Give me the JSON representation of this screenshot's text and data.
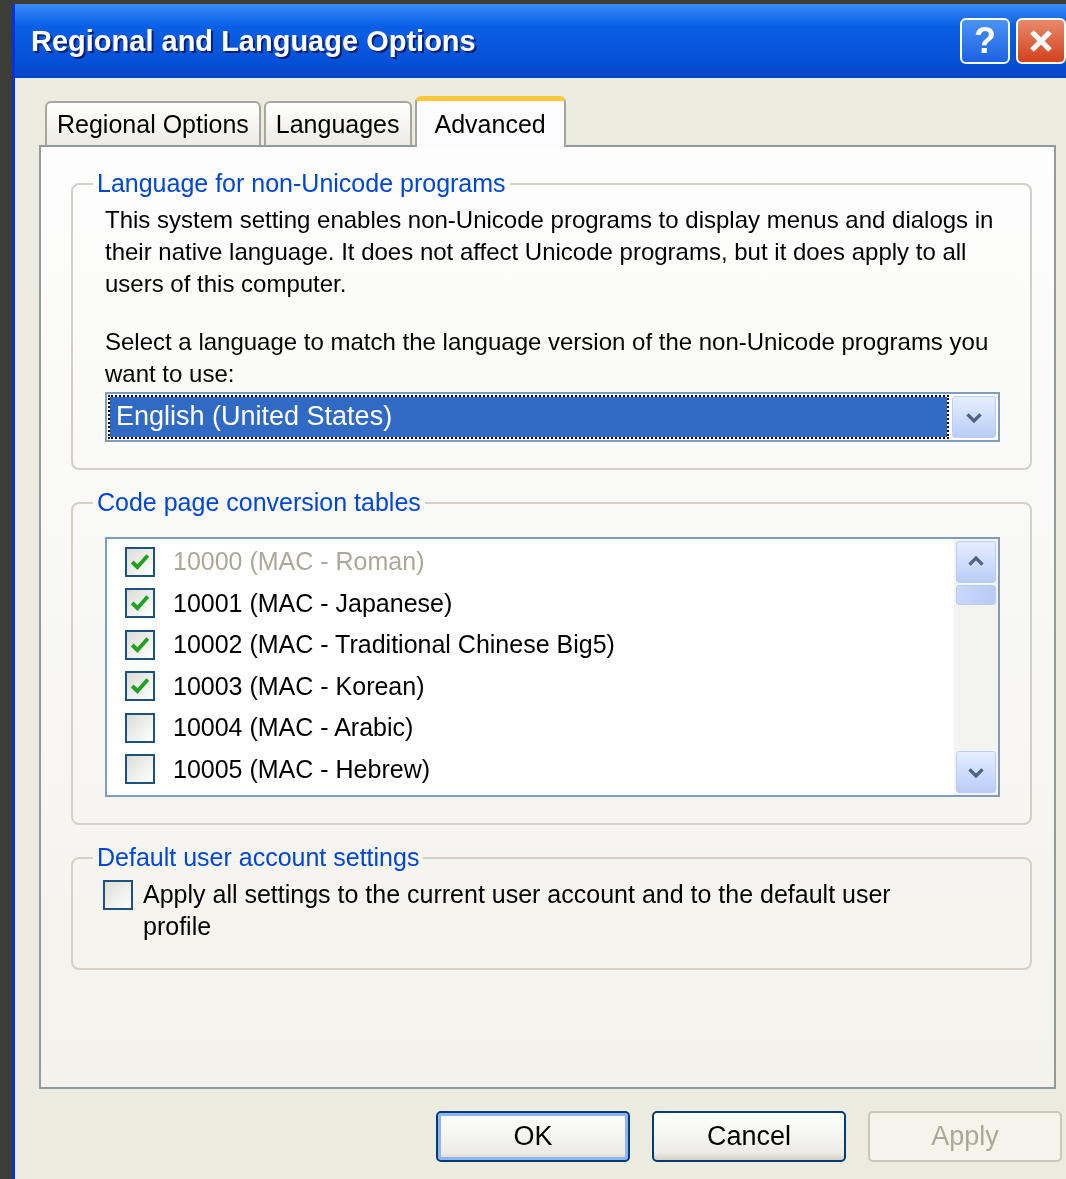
{
  "window": {
    "title": "Regional and Language Options",
    "help_label": "?"
  },
  "tabs": [
    {
      "label": "Regional Options",
      "selected": false
    },
    {
      "label": "Languages",
      "selected": false
    },
    {
      "label": "Advanced",
      "selected": true
    }
  ],
  "non_unicode": {
    "legend": "Language for non-Unicode programs",
    "description": "This system setting enables non-Unicode programs to display menus and dialogs in their native language. It does not affect Unicode programs, but it does apply to all users of this computer.",
    "prompt": "Select a language to match the language version of the non-Unicode programs you want to use:",
    "language": "English (United States)"
  },
  "code_pages": {
    "legend": "Code page conversion tables",
    "items": [
      {
        "label": "10000 (MAC - Roman)",
        "checked": true,
        "disabled": true
      },
      {
        "label": "10001 (MAC - Japanese)",
        "checked": true,
        "disabled": false
      },
      {
        "label": "10002 (MAC - Traditional Chinese Big5)",
        "checked": true,
        "disabled": false
      },
      {
        "label": "10003 (MAC - Korean)",
        "checked": true,
        "disabled": false
      },
      {
        "label": "10004 (MAC - Arabic)",
        "checked": false,
        "disabled": false
      },
      {
        "label": "10005 (MAC - Hebrew)",
        "checked": false,
        "disabled": false
      }
    ]
  },
  "default_account": {
    "legend": "Default user account settings",
    "label": "Apply all settings to the current user account and to the default user profile",
    "checked": false
  },
  "buttons": [
    {
      "label": "OK",
      "disabled": false,
      "default": true
    },
    {
      "label": "Cancel",
      "disabled": false,
      "default": false
    },
    {
      "label": "Apply",
      "disabled": true,
      "default": false
    }
  ]
}
